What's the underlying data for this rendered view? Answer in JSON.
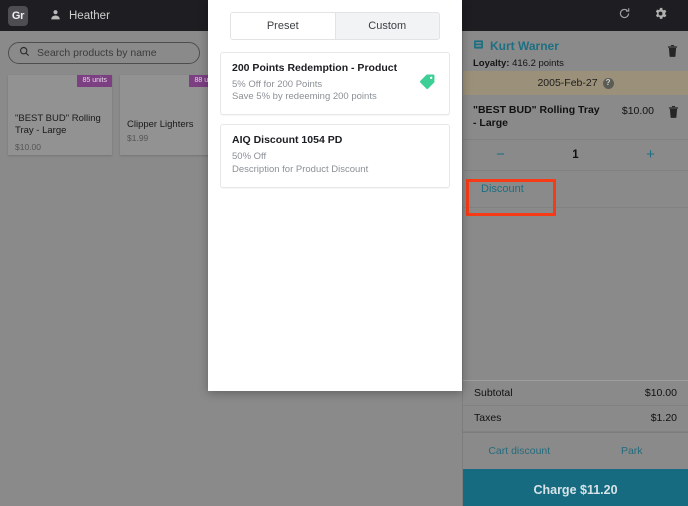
{
  "topbar": {
    "logo": "Gr",
    "user": "Heather",
    "refresh_icon": "refresh-icon",
    "settings_icon": "gear-icon"
  },
  "search": {
    "placeholder": "Search products by name",
    "value": "",
    "icon": "search-icon"
  },
  "products": [
    {
      "name": "\"BEST BUD\" Rolling Tray - Large",
      "price": "$10.00",
      "units": "85 units"
    },
    {
      "name": "Clipper Lighters",
      "price": "$1.99",
      "units": "88 units"
    }
  ],
  "modal": {
    "tabs": [
      {
        "label": "Preset",
        "active": true
      },
      {
        "label": "Custom",
        "active": false
      }
    ],
    "discounts": [
      {
        "title": "200 Points Redemption - Product",
        "subtitle": "5% Off for 200 Points",
        "description": "Save 5% by redeeming 200 points",
        "icon": "tag-icon",
        "icon_color": "#3ecf96"
      },
      {
        "title": "AIQ Discount 1054 PD",
        "subtitle": "50% Off",
        "description": "Description for Product Discount",
        "icon": "",
        "icon_color": ""
      }
    ]
  },
  "cart": {
    "customer": {
      "name": "Kurt Warner",
      "icon": "customer-card-icon",
      "loyalty_label": "Loyalty:",
      "loyalty_value": "416.2 points",
      "remove_icon": "trash-icon"
    },
    "date_banner": {
      "date": "2005-Feb-27",
      "help_icon": "question-mark-icon"
    },
    "line_item": {
      "name": "\"BEST BUD\" Rolling Tray - Large",
      "price": "$10.00",
      "remove_icon": "trash-icon",
      "decrement": "−",
      "quantity": "1",
      "increment": "+",
      "discount_label": "Discount"
    },
    "totals": [
      {
        "label": "Subtotal",
        "value": "$10.00"
      },
      {
        "label": "Taxes",
        "value": "$1.20"
      }
    ],
    "actions": [
      {
        "label": "Cart discount"
      },
      {
        "label": "Park"
      }
    ],
    "charge_label": "Charge $11.20"
  },
  "colors": {
    "accent_teal": "#1d6f82",
    "charge_button": "#176b80",
    "highlight_box": "#f73b16",
    "badge_purple": "#7b3f82",
    "date_banner": "#9b9079",
    "tag_green": "#3ecf96"
  }
}
